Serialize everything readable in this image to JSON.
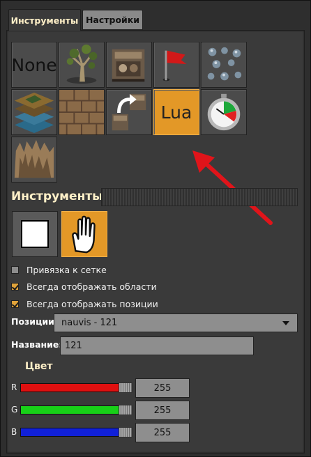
{
  "tabs": {
    "tools": "Инструменты",
    "settings": "Настройки"
  },
  "grid": {
    "items": [
      {
        "name": "none",
        "label": "None",
        "selected": false
      },
      {
        "name": "tree",
        "label": "",
        "selected": false
      },
      {
        "name": "entity",
        "label": "",
        "selected": false
      },
      {
        "name": "flag",
        "label": "",
        "selected": false
      },
      {
        "name": "resources",
        "label": "",
        "selected": false
      },
      {
        "name": "tiles",
        "label": "",
        "selected": false
      },
      {
        "name": "decoratives",
        "label": "",
        "selected": false
      },
      {
        "name": "clone",
        "label": "",
        "selected": false
      },
      {
        "name": "lua",
        "label": "Lua",
        "selected": true
      },
      {
        "name": "time",
        "label": "",
        "selected": false
      },
      {
        "name": "cliff",
        "label": "",
        "selected": false
      }
    ]
  },
  "tools_section": {
    "title": "Инструменты"
  },
  "mode_buttons": {
    "selected": "hand"
  },
  "checkboxes": [
    {
      "label": "Привязка к сетке",
      "checked": false
    },
    {
      "label": "Всегда отображать области",
      "checked": true
    },
    {
      "label": "Всегда отображать позиции",
      "checked": true
    }
  ],
  "positions": {
    "label": "Позиции",
    "value": "nauvis - 121"
  },
  "name_field": {
    "label": "Название:",
    "value": "121"
  },
  "color": {
    "title": "Цвет",
    "channels": [
      {
        "label": "R",
        "value": "255",
        "color": "#e01010",
        "fraction": 1.0
      },
      {
        "label": "G",
        "value": "255",
        "color": "#18d018",
        "fraction": 1.0
      },
      {
        "label": "B",
        "value": "255",
        "color": "#1020d8",
        "fraction": 1.0
      }
    ]
  },
  "colors": {
    "accent": "#e39827",
    "heading": "#fff0c8",
    "arrow": "#e0141a"
  }
}
